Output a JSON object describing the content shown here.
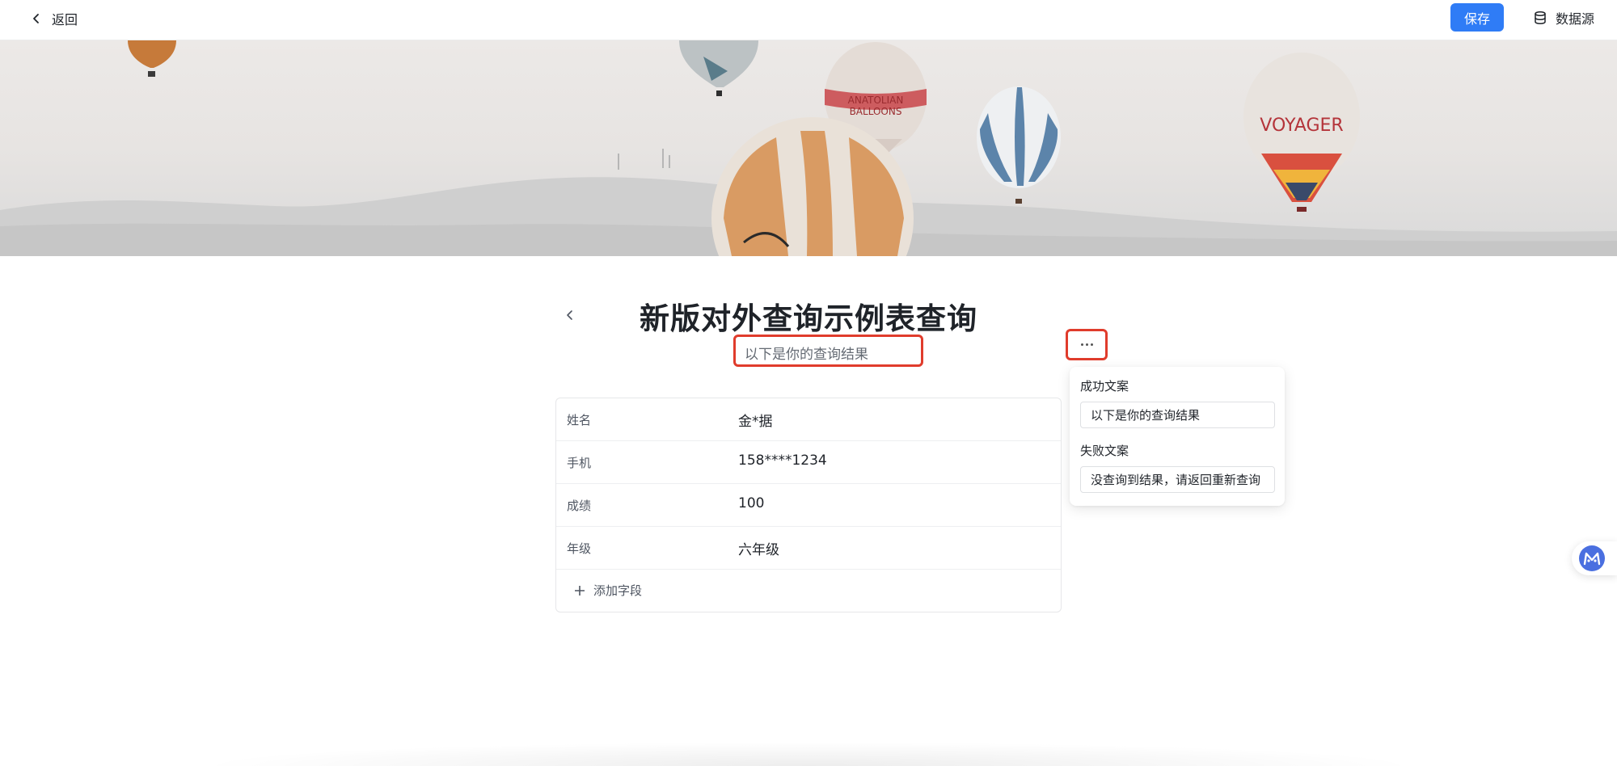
{
  "header": {
    "back_label": "返回",
    "save_label": "保存",
    "datasource_label": "数据源",
    "accent_color": "#2f7cf6"
  },
  "banner": {
    "image": "hot-air-balloons-over-hills",
    "balloon_lettering": [
      "VOYAGER",
      "ANATOLIAN BALLOONS"
    ]
  },
  "page": {
    "title": "新版对外查询示例表查询",
    "subtitle": "以下是你的查询结果",
    "highlight_color": "#e03c2c"
  },
  "popover": {
    "success_label": "成功文案",
    "success_value": "以下是你的查询结果",
    "fail_label": "失败文案",
    "fail_value": "没查询到结果，请返回重新查询"
  },
  "form": {
    "rows": [
      {
        "label": "姓名",
        "value": "金*据"
      },
      {
        "label": "手机",
        "value": "158****1234"
      },
      {
        "label": "成绩",
        "value": "100"
      },
      {
        "label": "年级",
        "value": "六年级"
      }
    ],
    "add_field_label": "添加字段"
  }
}
